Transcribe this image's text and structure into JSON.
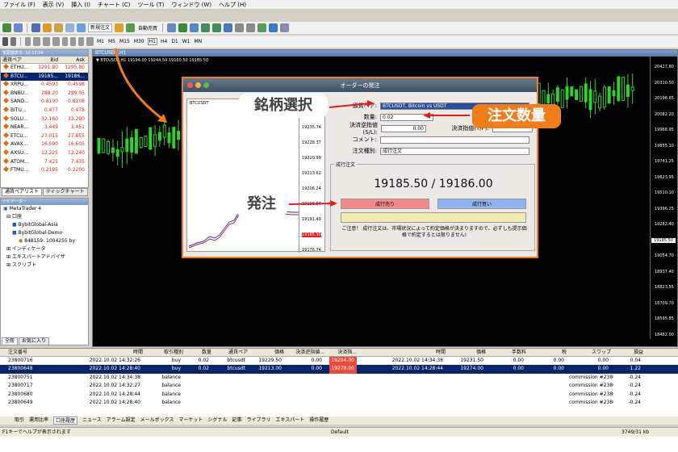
{
  "menu": [
    "ファイル (F)",
    "表示 (V)",
    "挿入 (I)",
    "チャート (C)",
    "ツール (T)",
    "ウィンドウ (W)",
    "ヘルプ (H)"
  ],
  "toolbar": {
    "new_order": "新規注文",
    "auto_trade": "自動売買",
    "timeframes": [
      "M1",
      "M5",
      "M15",
      "M30",
      "H1",
      "H4",
      "D1",
      "W1",
      "MN"
    ]
  },
  "market_watch": {
    "title": "気配値表示: 10:11:04",
    "headers": [
      "通貨ペア",
      "Bid",
      "Ask"
    ],
    "rows": [
      [
        "ETHU...",
        "1291.80",
        "1295.80"
      ],
      [
        "BTCU...",
        "19185...",
        "19186..."
      ],
      [
        "XRPU...",
        "0.4593",
        "0.4598"
      ],
      [
        "BNBU...",
        "288.20",
        "289.05"
      ],
      [
        "SAND...",
        "0.8100",
        "0.8108"
      ],
      [
        "BITU...",
        "0.477",
        "0.478"
      ],
      [
        "SOLU...",
        "32.160",
        "32.290"
      ],
      [
        "NEAR...",
        "3.449",
        "3.451"
      ],
      [
        "ETCU...",
        "27.015",
        "27.855"
      ],
      [
        "AVAX...",
        "16.590",
        "16.605"
      ],
      [
        "AXSU...",
        "12.225",
        "12.240"
      ],
      [
        "ATOM...",
        "7.425",
        "7.435"
      ],
      [
        "FTMU...",
        "0.2195",
        "0.2200"
      ]
    ],
    "tabs": [
      "通貨ペアリスト",
      "ティックチャート"
    ]
  },
  "navigator": {
    "title": "ナビゲーター",
    "items": [
      "MetaTrader 4",
      "口座",
      "BybitGlobal-Asia",
      "BybitGlobal-Demo",
      "848159: 1004255 by",
      "インディケータ",
      "エキスパートアドバイザ",
      "スクリプト"
    ],
    "tabs": [
      "全般",
      "お気に入り"
    ]
  },
  "chart": {
    "title": "BTCUSDT,H1",
    "info": "▼ BTCUSDT,H1 19194.00 19244.50 19160.50 19185.50",
    "prices": [
      "20427.80",
      "20310.50",
      "20196.65",
      "20082.20",
      "19968.95",
      "19855.10",
      "19741.25",
      "19623.95",
      "19510.10",
      "19396.25",
      "19282.40",
      "19185.50",
      "19054.70",
      "18937.40",
      "18823.55",
      "18709.70",
      "18595.85",
      "18482.00"
    ],
    "current": "19185.50"
  },
  "dialog": {
    "title": "オーダーの発注",
    "symbol_label": "通貨ペア:",
    "symbol": "BTCUSDT, Bitcoin vs USDT",
    "qty_label": "数量:",
    "qty": "0.02",
    "sl_label": "決済逆指値(S/L):",
    "sl": "0.00",
    "tp_label": "決済指値(T/P):",
    "comment_label": "コメント:",
    "type_label": "注文種別:",
    "type": "成行注文",
    "group": "成行注文",
    "quote": "19185.50 / 19186.00",
    "sell": "成行売り",
    "buy": "成行買い",
    "note": "ご注意！ 成行注文は、市場状況によって約定価格が決まりますので、必ずしも提示価格で約定するとは限りません!",
    "mini_label": "BTCUSDT",
    "mini_prices": [
      "19235.74",
      "19228.37",
      "19220.99",
      "19213.62",
      "19206.24",
      "19198.87",
      "19191.49",
      "19185.50",
      "19176.74"
    ]
  },
  "callouts": {
    "symbol": "銘柄選択",
    "qty": "注文数量",
    "order": "発注"
  },
  "terminal": {
    "headers": [
      "注文番号",
      "時間",
      "取引種別",
      "数量",
      "通貨ペア",
      "価格",
      "決済逆指値...",
      "決済指...",
      "時間",
      "価格",
      "手数料",
      "税",
      "スワップ",
      "損益"
    ],
    "rows": [
      [
        "23800716",
        "2022.10.02 14:32:26",
        "buy",
        "0.02",
        "btcusdt",
        "19229.50",
        "0.00",
        "19294.00",
        "2022.10.02 14:34:38",
        "19231.50",
        "0.00",
        "0.00",
        "0.00",
        "0.04"
      ],
      [
        "23800648",
        "2022.10.02 14:28:40",
        "buy",
        "0.02",
        "btcusdt",
        "19213.00",
        "0.00",
        "19278.00",
        "2022.10.02 14:28:44",
        "19274.00",
        "0.00",
        "0.00",
        "0.00",
        "1.22"
      ],
      [
        "23800751",
        "2022.10.02 14:34:38",
        "balance",
        "",
        "",
        "",
        "",
        "",
        "",
        "",
        "",
        "",
        "commission #23800716",
        "-0.24"
      ],
      [
        "23800717",
        "2022.10.02 14:32:27",
        "balance",
        "",
        "",
        "",
        "",
        "",
        "",
        "",
        "",
        "",
        "commission #23800716",
        "-0.24"
      ],
      [
        "23800680",
        "2022.10.02 14:28:44",
        "balance",
        "",
        "",
        "",
        "",
        "",
        "",
        "",
        "",
        "",
        "commission #23800648",
        "-0.24"
      ],
      [
        "23800649",
        "2022.10.02 14:28:40",
        "balance",
        "",
        "",
        "",
        "",
        "",
        "",
        "",
        "",
        "",
        "commission #23800648",
        "-0.24"
      ]
    ]
  },
  "bottom_tabs": [
    "取引",
    "運用比率",
    "口座履歴",
    "ニュース",
    "アラーム設定",
    "メールボックス",
    "マーケット",
    "シグナル",
    "記事",
    "ライブラリ",
    "エキスパート",
    "操作履歴"
  ],
  "status": {
    "help": "F1キーでヘルプが表示されます",
    "profile": "Default",
    "traffic": "3749/31 kb"
  }
}
